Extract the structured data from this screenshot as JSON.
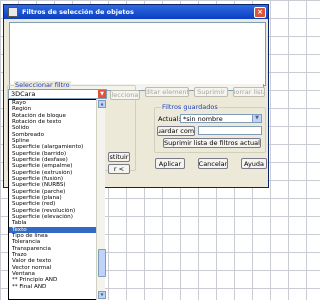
{
  "dialog": {
    "title": "Filtros de selección de objetos",
    "close_glyph": "×"
  },
  "select_filter": {
    "legend": "Seleccionar filtro",
    "selected_value": "3DCara",
    "select_button": "Seleccionar...",
    "options": [
      "Rayo",
      "Región",
      "Rotación de bloque",
      "Rotación de texto",
      "Sólido",
      "Sombreado",
      "Spline",
      "Superficie (alargamiento)",
      "Superficie (barrido)",
      "Superficie (desfase)",
      "Superficie (empalme)",
      "Superficie (extrusión)",
      "Superficie (fusión)",
      "Superficie (NURBS)",
      "Superficie (parche)",
      "Superficie (plana)",
      "Superficie (red)",
      "Superficie (revolución)",
      "Superficie (elevación)",
      "Tabla",
      "Texto",
      "Tipo de línea",
      "Tolerancia",
      "Transparencia",
      "Trazo",
      "Valor de texto",
      "Vector normal",
      "Ventana",
      "** Principio    AND",
      "** Final    AND"
    ],
    "highlighted_option": "Texto"
  },
  "actions": {
    "edit_item": "Editar elemento",
    "delete": "Suprimir",
    "clear_list": "Borrar lista",
    "substitute": "stituir",
    "add_selected": "r <"
  },
  "saved_filters": {
    "legend": "Filtros guardados",
    "current_label": "Actual:",
    "current_value": "*sin nombre",
    "save_as_button": "Guardar como:",
    "save_as_value": "",
    "delete_current_button": "Suprimir lista de filtros actual"
  },
  "footer": {
    "apply": "Aplicar",
    "cancel": "Cancelar",
    "help": "Ayuda"
  }
}
